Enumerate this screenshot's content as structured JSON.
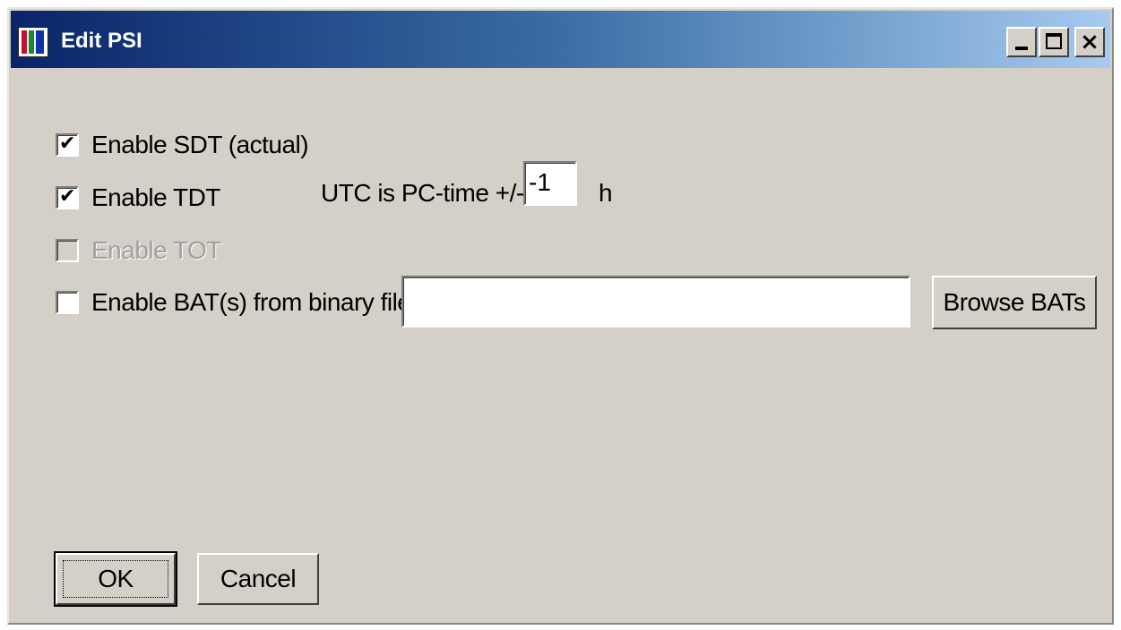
{
  "window": {
    "title": "Edit PSI",
    "icon": "app-icon-r",
    "controls": {
      "minimize": "minimize-icon",
      "maximize": "maximize-icon",
      "close": "close-icon",
      "close_glyph": "×"
    }
  },
  "options": {
    "sdt": {
      "label": "Enable SDT (actual)",
      "checked": true,
      "enabled": true
    },
    "tdt": {
      "label": "Enable TDT",
      "checked": true,
      "enabled": true
    },
    "tot": {
      "label": "Enable TOT",
      "checked": false,
      "enabled": false
    },
    "bat": {
      "label": "Enable BAT(s) from binary file:",
      "checked": false,
      "enabled": true
    }
  },
  "utc": {
    "label": "UTC is PC-time +/-",
    "value": "-1",
    "unit": "h"
  },
  "bat_file": {
    "value": "",
    "browse_label": "Browse BATs"
  },
  "buttons": {
    "ok_label": "OK",
    "cancel_label": "Cancel"
  },
  "checkmark_glyph": "✔"
}
